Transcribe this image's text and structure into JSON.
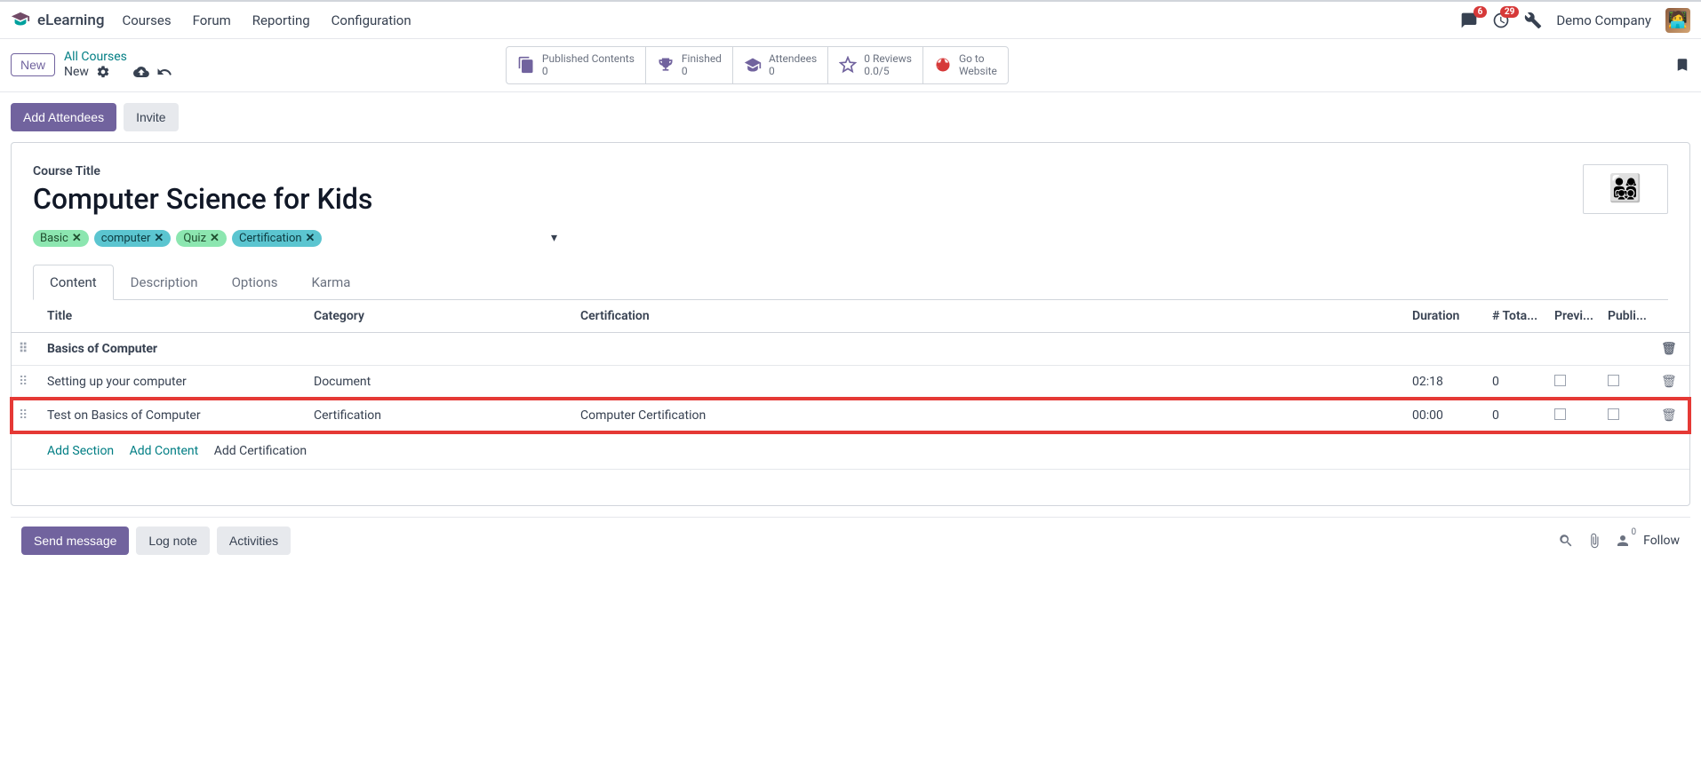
{
  "nav": {
    "brand": "eLearning",
    "links": [
      "Courses",
      "Forum",
      "Reporting",
      "Configuration"
    ],
    "badge_messages": "6",
    "badge_activities": "29",
    "company": "Demo Company"
  },
  "controlbar": {
    "new_btn": "New",
    "breadcrumb_root": "All Courses",
    "breadcrumb_current": "New",
    "stats": [
      {
        "label": "Published Contents",
        "value": "0"
      },
      {
        "label": "Finished",
        "value": "0"
      },
      {
        "label": "Attendees",
        "value": "0"
      },
      {
        "label_top": "0 Reviews",
        "value": "0.0/5"
      },
      {
        "label_top": "Go to",
        "value": "Website"
      }
    ]
  },
  "actions": {
    "add_attendees": "Add Attendees",
    "invite": "Invite"
  },
  "course": {
    "label": "Course Title",
    "title": "Computer Science for Kids",
    "tags": [
      {
        "text": "Basic",
        "cls": "tag-green"
      },
      {
        "text": "computer",
        "cls": "tag-teal"
      },
      {
        "text": "Quiz",
        "cls": "tag-green"
      },
      {
        "text": "Certification",
        "cls": "tag-teal"
      }
    ]
  },
  "tabs": [
    "Content",
    "Description",
    "Options",
    "Karma"
  ],
  "table": {
    "headers": {
      "title": "Title",
      "category": "Category",
      "certification": "Certification",
      "duration": "Duration",
      "total": "# Tota...",
      "preview": "Previ...",
      "published": "Publi..."
    },
    "section": "Basics of Computer",
    "rows": [
      {
        "title": "Setting up your computer",
        "category": "Document",
        "certification": "",
        "duration": "02:18",
        "total": "0"
      },
      {
        "title": "Test on Basics of Computer",
        "category": "Certification",
        "certification": "Computer Certification",
        "duration": "00:00",
        "total": "0",
        "highlight": true
      }
    ],
    "add_section": "Add Section",
    "add_content": "Add Content",
    "add_certification": "Add Certification"
  },
  "chatter": {
    "send": "Send message",
    "log": "Log note",
    "activities": "Activities",
    "follower_count": "0",
    "follow": "Follow"
  }
}
